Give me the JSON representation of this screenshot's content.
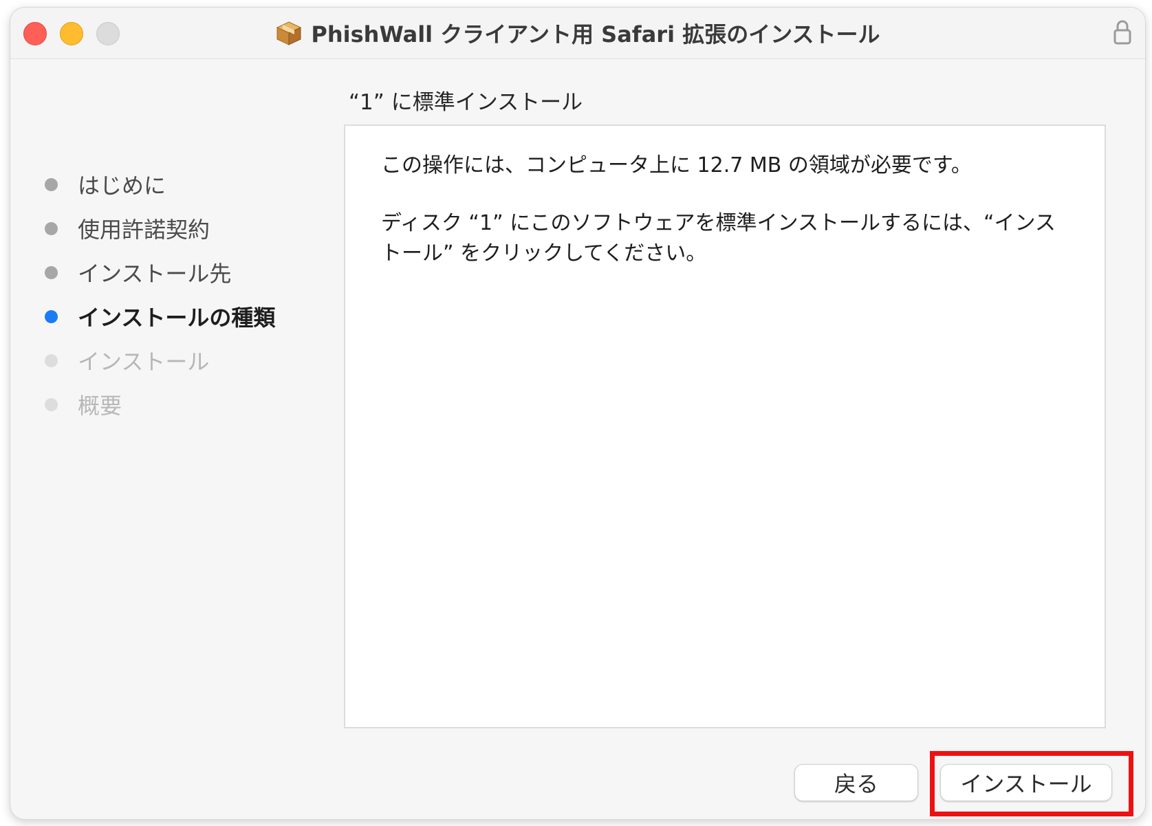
{
  "window": {
    "title": "PhishWall クライアント用 Safari 拡張のインストール",
    "app_icon": "package-icon",
    "lock_icon": "lock-icon"
  },
  "sidebar": {
    "steps": [
      {
        "label": "はじめに",
        "state": "done"
      },
      {
        "label": "使用許諾契約",
        "state": "done"
      },
      {
        "label": "インストール先",
        "state": "done"
      },
      {
        "label": "インストールの種類",
        "state": "current"
      },
      {
        "label": "インストール",
        "state": "pending"
      },
      {
        "label": "概要",
        "state": "pending"
      }
    ]
  },
  "main": {
    "heading": "“1” に標準インストール",
    "paragraph1": "この操作には、コンピュータ上に 12.7 MB の領域が必要です。",
    "paragraph2": "ディスク “1” にこのソフトウェアを標準インストールするには、“インストール” をクリックしてください。"
  },
  "buttons": {
    "back_label": "戻る",
    "install_label": "インストール"
  },
  "colors": {
    "current_step": "#1a7cf5",
    "highlight": "#ee1111",
    "close": "#fe5f57",
    "minimize": "#febc2e"
  }
}
